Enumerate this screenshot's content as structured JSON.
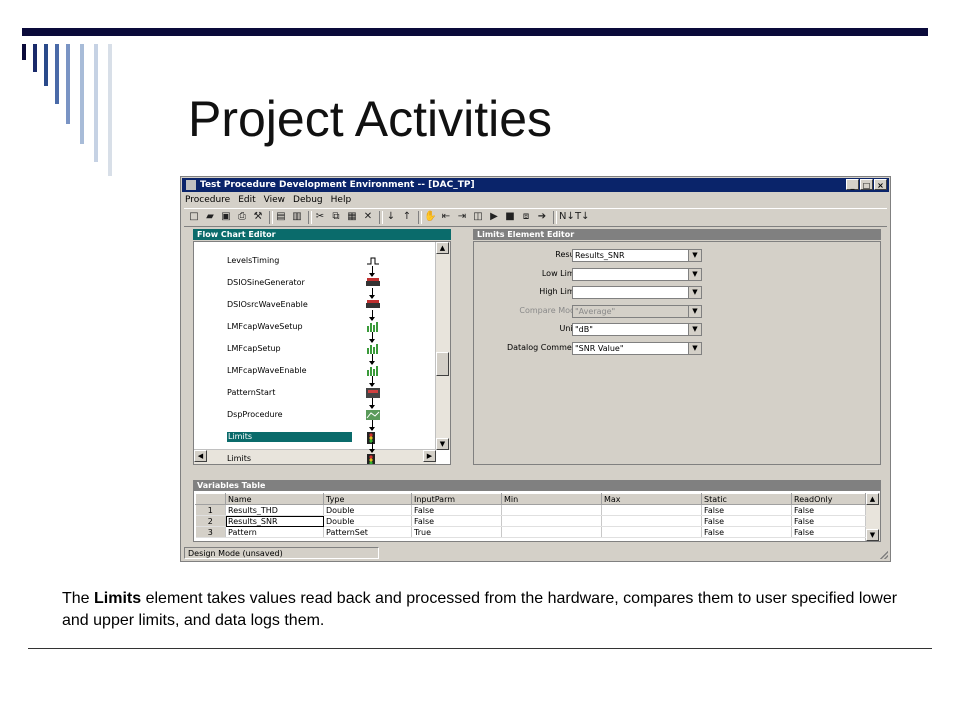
{
  "slide": {
    "title": "Project Activities",
    "caption_bold": "Limits",
    "caption_before": "The ",
    "caption_after": " element takes values read back and processed from the hardware, compares them to user specified lower and upper limits, and data logs them.",
    "accent_color": "#0a0a3a",
    "bar_colors": [
      "#0a0a3a",
      "#1a2a6a",
      "#2a4a8a",
      "#4a6aa8",
      "#7a94c4",
      "#a8bcd8",
      "#c6d2e4",
      "#d8dfe8"
    ]
  },
  "window": {
    "title": "Test Procedure Development Environment -- [DAC_TP]",
    "menu": [
      "Procedure",
      "Edit",
      "View",
      "Debug",
      "Help"
    ],
    "title_buttons": [
      "_",
      "□",
      "×"
    ],
    "toolbar_icons": [
      "new-icon",
      "open-icon",
      "save-icon",
      "print-icon",
      "wand-icon",
      "insert-icon",
      "insert-var-icon",
      "cut-icon",
      "copy-icon",
      "paste-icon",
      "delete-icon",
      "step-into-icon",
      "step-out-icon",
      "hand-icon",
      "back-icon",
      "run-icon",
      "pause-icon",
      "play-icon",
      "stop-icon",
      "step-icon",
      "go-icon",
      "sort-desc-icon",
      "sort-asc-icon"
    ],
    "status": "Design Mode (unsaved)"
  },
  "flow_chart": {
    "header": "Flow Chart Editor",
    "items": [
      {
        "label": "LevelsTiming",
        "icon": "levels-icon"
      },
      {
        "label": "DSIOSineGenerator",
        "icon": "dsio-icon"
      },
      {
        "label": "DSIOsrcWaveEnable",
        "icon": "dsio-icon"
      },
      {
        "label": "LMFcapWaveSetup",
        "icon": "capture-icon"
      },
      {
        "label": "LMFcapSetup",
        "icon": "capture-icon"
      },
      {
        "label": "LMFcapWaveEnable",
        "icon": "capture-icon"
      },
      {
        "label": "PatternStart",
        "icon": "pattern-icon"
      },
      {
        "label": "DspProcedure",
        "icon": "dsp-icon"
      },
      {
        "label": "Limits",
        "icon": "traffic-light-icon",
        "selected": true
      },
      {
        "label": "Limits",
        "icon": "traffic-light-icon"
      }
    ]
  },
  "limits_editor": {
    "header": "Limits Element Editor",
    "fields": [
      {
        "label": "Result",
        "value": "Results_SNR",
        "disabled": false
      },
      {
        "label": "Low Limit",
        "value": "",
        "disabled": false
      },
      {
        "label": "High Limit",
        "value": "",
        "disabled": false
      },
      {
        "label": "Compare Mode",
        "value": "\"Average\"",
        "disabled": true
      },
      {
        "label": "Units",
        "value": "\"dB\"",
        "disabled": false
      },
      {
        "label": "Datalog Comment",
        "value": "\"SNR Value\"",
        "disabled": false
      }
    ]
  },
  "variables_table": {
    "header": "Variables Table",
    "columns": [
      "",
      "Name",
      "Type",
      "InputParm",
      "Min",
      "Max",
      "Static",
      "ReadOnly"
    ],
    "rows": [
      [
        "1",
        "Results_THD",
        "Double",
        "False",
        "",
        "",
        "False",
        "False"
      ],
      [
        "2",
        "Results_SNR",
        "Double",
        "False",
        "",
        "",
        "False",
        "False"
      ],
      [
        "3",
        "Pattern",
        "PatternSet",
        "True",
        "",
        "",
        "False",
        "False"
      ]
    ]
  }
}
